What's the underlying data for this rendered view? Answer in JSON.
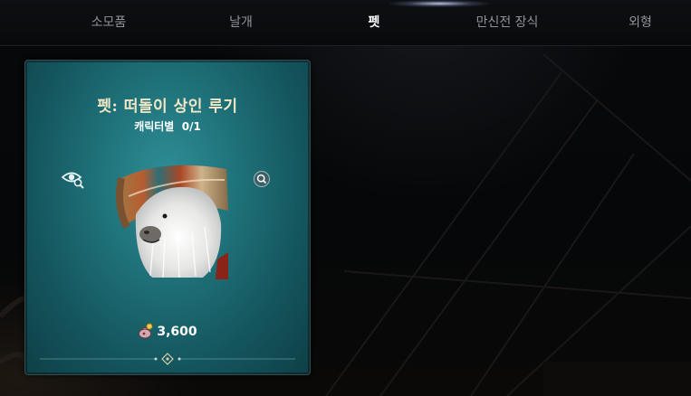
{
  "tabs": [
    {
      "label": "소모품",
      "active": false
    },
    {
      "label": "날개",
      "active": false
    },
    {
      "label": "펫",
      "active": true
    },
    {
      "label": "만신전 장식",
      "active": false
    },
    {
      "label": "외형",
      "active": false
    }
  ],
  "card": {
    "title": "펫: 떠돌이 상인 루기",
    "limit_label": "캐릭터별",
    "limit_value": "0/1",
    "price": "3,600",
    "icons": {
      "preview": "eye-search-icon",
      "zoom": "magnifier-icon",
      "currency": "coin-pouch-icon"
    }
  },
  "colors": {
    "card_teal": "#1e6f77",
    "title_gold": "#f3e7c6",
    "tab_active": "#ffffff",
    "tab_inactive": "#8f9499"
  }
}
